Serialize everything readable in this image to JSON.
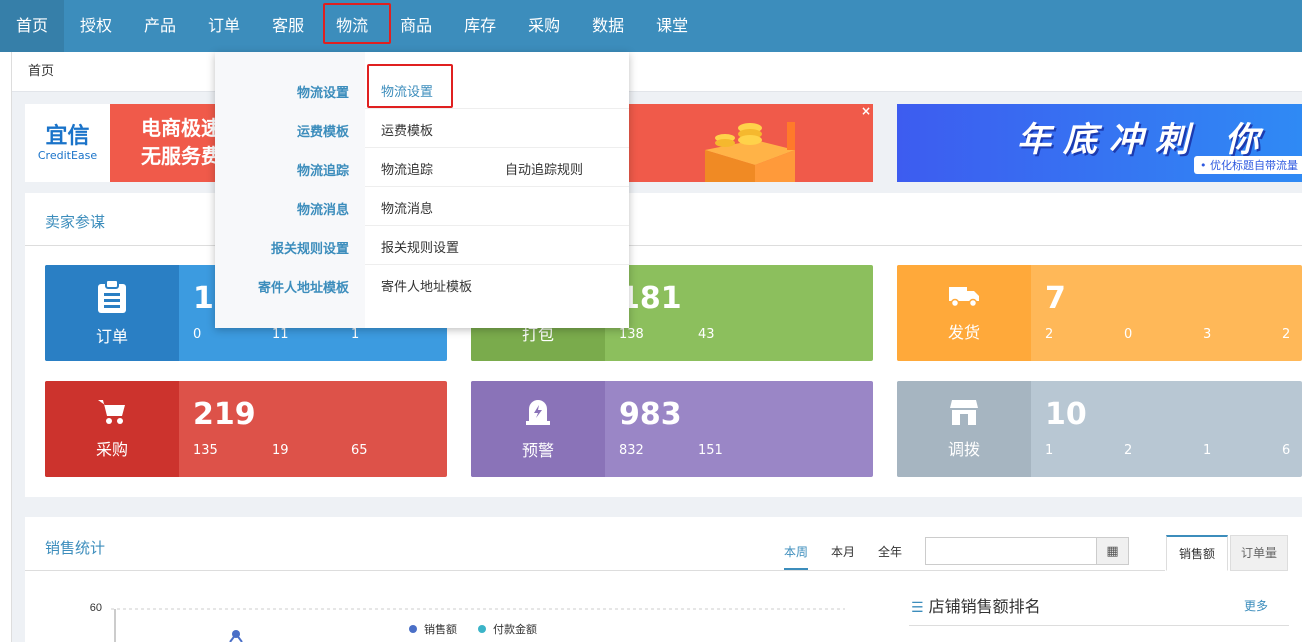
{
  "nav": {
    "items": [
      "首页",
      "授权",
      "产品",
      "订单",
      "客服",
      "物流",
      "商品",
      "库存",
      "采购",
      "数据",
      "课堂"
    ]
  },
  "breadcrumb": "首页",
  "banner1": {
    "logo_main": "宜信",
    "logo_sub": "CreditEase",
    "line1": "电商极速",
    "line2": "无服务费",
    "close": "×"
  },
  "banner2": {
    "title": "年底冲刺 你",
    "subtitle": "• 优化标题自带流量"
  },
  "panel": {
    "title": "卖家参谋"
  },
  "stats": {
    "order": {
      "label": "订单",
      "value": "12",
      "subs": [
        "0",
        "11",
        "1"
      ]
    },
    "pack": {
      "label": "打包",
      "value": "181",
      "subs": [
        "138",
        "43"
      ]
    },
    "ship": {
      "label": "发货",
      "value": "7",
      "subs": [
        "2",
        "0",
        "3",
        "2"
      ]
    },
    "buy": {
      "label": "采购",
      "value": "219",
      "subs": [
        "135",
        "19",
        "65"
      ]
    },
    "warn": {
      "label": "预警",
      "value": "983",
      "subs": [
        "832",
        "151"
      ]
    },
    "move": {
      "label": "调拨",
      "value": "10",
      "subs": [
        "1",
        "2",
        "1",
        "6"
      ]
    }
  },
  "sales": {
    "title": "销售统计",
    "periods": [
      "本周",
      "本月",
      "全年"
    ],
    "date_value": "",
    "tabs": [
      "销售额",
      "订单量"
    ],
    "rank_title": "店铺销售额排名",
    "rank_more": "更多",
    "rank_icon": "list-icon"
  },
  "chart_data": {
    "type": "line",
    "y_tick_top": "60",
    "legend": [
      "销售额",
      "付款金额"
    ],
    "colors": {
      "sales": "#4a6fc7",
      "paid": "#3bb4c8"
    }
  },
  "dropdown": {
    "categories": [
      "物流设置",
      "运费模板",
      "物流追踪",
      "物流消息",
      "报关规则设置",
      "寄件人地址模板"
    ],
    "rows": [
      {
        "label": "物流设置",
        "extra": ""
      },
      {
        "label": "运费模板",
        "extra": ""
      },
      {
        "label": "物流追踪",
        "extra": "自动追踪规则"
      },
      {
        "label": "物流消息",
        "extra": ""
      },
      {
        "label": "报关规则设置",
        "extra": ""
      },
      {
        "label": "寄件人地址模板",
        "extra": ""
      }
    ]
  },
  "colors": {
    "nav_bg": "#3c8dbc",
    "accent": "#3c8dbc",
    "highlight_red": "#e02020"
  }
}
